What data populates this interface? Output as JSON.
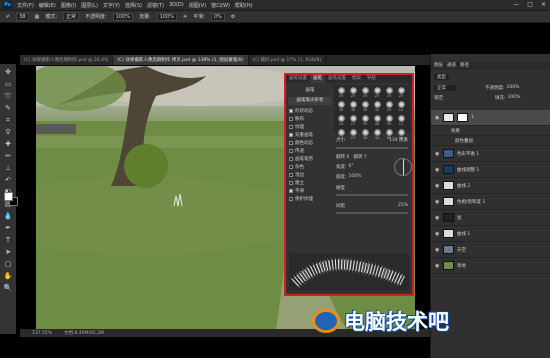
{
  "menubar": {
    "logo": "Ps",
    "items": [
      "文件(F)",
      "编辑(E)",
      "图像(I)",
      "图层(L)",
      "文字(Y)",
      "选择(S)",
      "滤镜(T)",
      "3D(D)",
      "视图(V)",
      "窗口(W)",
      "帮助(H)"
    ],
    "window_controls": [
      "—",
      "□",
      "✕"
    ]
  },
  "options_bar": {
    "brush_size": "38",
    "mode_label": "模式:",
    "mode_value": "正常",
    "opacity_label": "不透明度:",
    "opacity_value": "100%",
    "flow_label": "流量:",
    "flow_value": "100%",
    "smooth_label": "平滑:",
    "smooth_value": "0%"
  },
  "doc_tabs": [
    {
      "label": "(C) 效果摄影人像后期制作.psd @ 26.4%",
      "active": false
    },
    {
      "label": "(C) 效果摄影人像后期制作 拷贝.psd @ 138% (1, 图层蒙版/8)",
      "active": true
    },
    {
      "label": "(C) 最好.psd @ 17% (1, RGB/8)",
      "active": false
    }
  ],
  "status_bar": {
    "zoom": "137.55%",
    "doc_size": "文档:8.49M/92.2M"
  },
  "brush_panel": {
    "tabs": [
      "画笔设置",
      "画笔",
      "画笔设置",
      "图案",
      "导航"
    ],
    "active_tab_index": 1,
    "top_button": "画笔",
    "preset_button": "画笔笔尖形状",
    "options": [
      {
        "label": "形状动态",
        "checked": true
      },
      {
        "label": "散布",
        "checked": false
      },
      {
        "label": "纹理",
        "checked": false
      },
      {
        "label": "双重画笔",
        "checked": true
      },
      {
        "label": "颜色动态",
        "checked": false
      },
      {
        "label": "传递",
        "checked": false
      },
      {
        "label": "画笔笔势",
        "checked": false
      },
      {
        "label": "杂色",
        "checked": false
      },
      {
        "label": "湿边",
        "checked": false
      },
      {
        "label": "建立",
        "checked": false
      },
      {
        "label": "平滑",
        "checked": true
      },
      {
        "label": "保护纹理",
        "checked": false
      }
    ],
    "brush_sizes": [
      "25",
      "25",
      "25",
      "25",
      "25",
      "25",
      "36",
      "36",
      "36",
      "32",
      "25",
      "14",
      "24",
      "27",
      "39",
      "46",
      "59",
      "11",
      "17",
      "23",
      "36",
      "44",
      "60",
      "14"
    ],
    "size_label": "大小",
    "size_value": "134 像素",
    "flip_x": "翻转 X",
    "flip_y": "翻转 Y",
    "angle_label": "角度:",
    "angle_value": "0°",
    "roundness_label": "圆度:",
    "roundness_value": "100%",
    "hardness_label": "硬度",
    "spacing_label": "间距",
    "spacing_value": "25%"
  },
  "layers_panel": {
    "tabs": [
      "图层",
      "通道",
      "路径"
    ],
    "filter_label": "类型",
    "blend_mode": "正常",
    "opacity_label": "不透明度:",
    "opacity_value": "100%",
    "lock_label": "锁定:",
    "fill_label": "填充:",
    "fill_value": "100%",
    "layers": [
      {
        "name": "1",
        "selected": true
      },
      {
        "name": "效果"
      },
      {
        "name": "颜色叠加"
      },
      {
        "name": "色彩平衡 1"
      },
      {
        "name": "曲线调整 1"
      },
      {
        "name": "曲线 2"
      },
      {
        "name": "色相/饱和度 1"
      },
      {
        "name": "鼠"
      },
      {
        "name": "曲线 1"
      },
      {
        "name": "天空"
      },
      {
        "name": "草地"
      }
    ]
  },
  "watermark": {
    "text": "电脑技术吧"
  }
}
